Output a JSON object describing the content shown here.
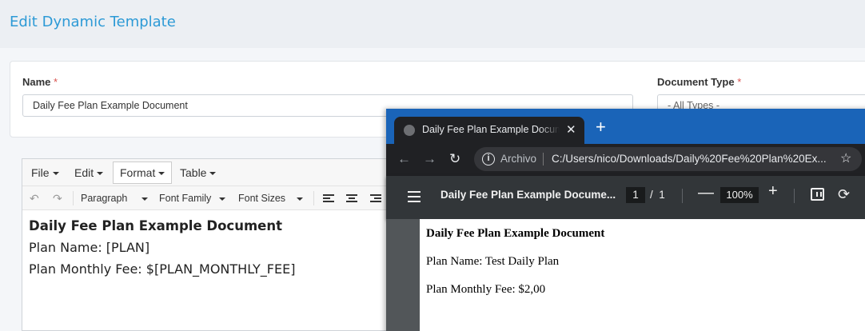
{
  "page": {
    "title": "Edit Dynamic Template"
  },
  "form": {
    "name_label": "Name",
    "required_mark": "*",
    "name_value": "Daily Fee Plan Example Document",
    "doctype_label": "Document Type",
    "doctype_value": "- All Types -"
  },
  "editor": {
    "menus": [
      "File",
      "Edit",
      "Format",
      "Table"
    ],
    "active_menu": "Format",
    "toolbar": {
      "block_format": "Paragraph",
      "font_family": "Font Family",
      "font_sizes": "Font Sizes"
    },
    "content": {
      "heading": "Daily Fee Plan Example Document",
      "line1": "Plan Name: [PLAN]",
      "line2": "Plan Monthly Fee: $[PLAN_MONTHLY_FEE]"
    }
  },
  "browser": {
    "tab_title": "Daily Fee Plan Example Document",
    "scheme_label": "Archivo",
    "url": "C:/Users/nico/Downloads/Daily%20Fee%20Plan%20Ex...",
    "colors": {
      "tabstrip": "#1a64b8",
      "window": "#202124"
    }
  },
  "pdf": {
    "title": "Daily Fee Plan Example Docume...",
    "current_page": "1",
    "page_separator": "/",
    "total_pages": "1",
    "zoom": "100%",
    "content": {
      "heading": "Daily Fee Plan Example Document",
      "line1": "Plan Name: Test Daily Plan",
      "line2": "Plan Monthly Fee: $2,00"
    }
  }
}
